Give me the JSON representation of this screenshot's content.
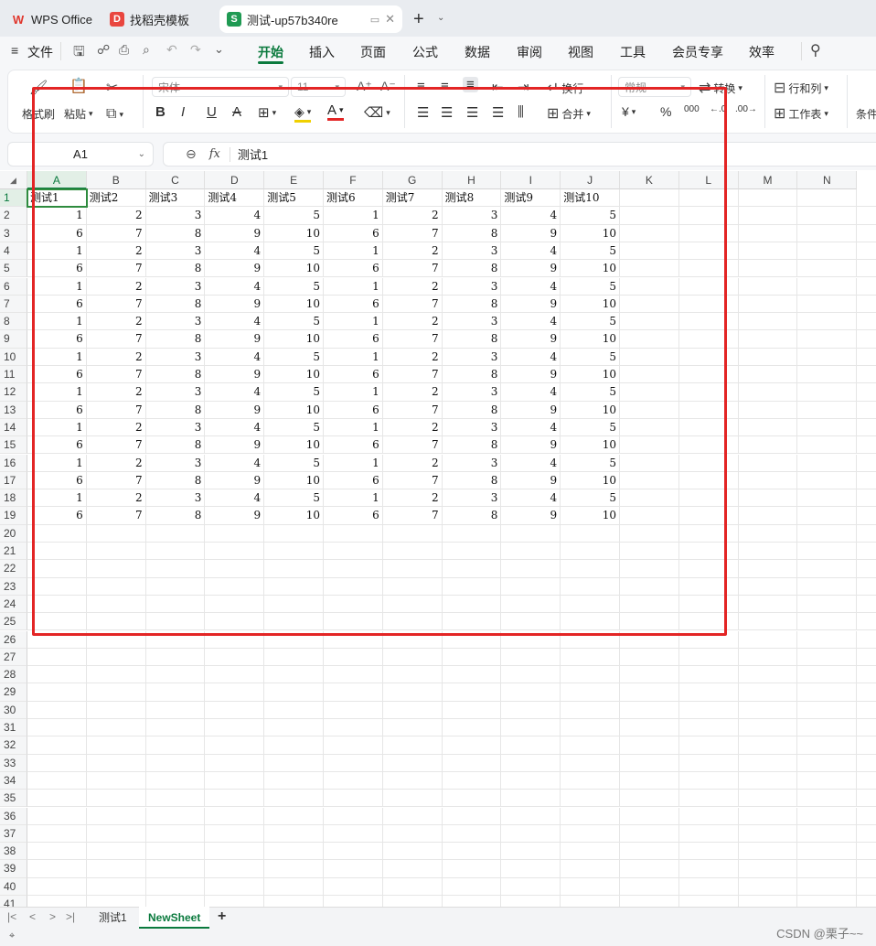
{
  "tabs": [
    {
      "label": "WPS Office",
      "icon": "wps-logo-icon"
    },
    {
      "label": "找稻壳模板",
      "icon": "docer-icon"
    },
    {
      "label": "测试-up57b340re",
      "icon": "spreadsheet-s-icon",
      "icon_text": "S"
    }
  ],
  "menu": {
    "file": "文件",
    "items": [
      "开始",
      "插入",
      "页面",
      "公式",
      "数据",
      "审阅",
      "视图",
      "工具",
      "会员专享",
      "效率"
    ],
    "active": "开始"
  },
  "ribbon": {
    "format_painter": "格式刷",
    "paste": "粘贴",
    "font_name": "宋体",
    "font_size": "11",
    "wrap": "换行",
    "merge": "合并",
    "number_format": "常规",
    "convert": "转换",
    "rows_cols": "行和列",
    "worksheet": "工作表",
    "conditional": "条件",
    "percent": "%",
    "thousands": "000",
    "currency": "¥"
  },
  "formula_bar": {
    "cell_ref": "A1",
    "fx": "fx",
    "content": "测试1"
  },
  "columns": [
    "A",
    "B",
    "C",
    "D",
    "E",
    "F",
    "G",
    "H",
    "I",
    "J",
    "K",
    "L",
    "M",
    "N"
  ],
  "row_count": 41,
  "headers": [
    "测试1",
    "测试2",
    "测试3",
    "测试4",
    "测试5",
    "测试6",
    "测试7",
    "测试8",
    "测试9",
    "测试10"
  ],
  "data_rows": [
    [
      1,
      2,
      3,
      4,
      5,
      1,
      2,
      3,
      4,
      5
    ],
    [
      6,
      7,
      8,
      9,
      10,
      6,
      7,
      8,
      9,
      10
    ],
    [
      1,
      2,
      3,
      4,
      5,
      1,
      2,
      3,
      4,
      5
    ],
    [
      6,
      7,
      8,
      9,
      10,
      6,
      7,
      8,
      9,
      10
    ],
    [
      1,
      2,
      3,
      4,
      5,
      1,
      2,
      3,
      4,
      5
    ],
    [
      6,
      7,
      8,
      9,
      10,
      6,
      7,
      8,
      9,
      10
    ],
    [
      1,
      2,
      3,
      4,
      5,
      1,
      2,
      3,
      4,
      5
    ],
    [
      6,
      7,
      8,
      9,
      10,
      6,
      7,
      8,
      9,
      10
    ],
    [
      1,
      2,
      3,
      4,
      5,
      1,
      2,
      3,
      4,
      5
    ],
    [
      6,
      7,
      8,
      9,
      10,
      6,
      7,
      8,
      9,
      10
    ],
    [
      1,
      2,
      3,
      4,
      5,
      1,
      2,
      3,
      4,
      5
    ],
    [
      6,
      7,
      8,
      9,
      10,
      6,
      7,
      8,
      9,
      10
    ],
    [
      1,
      2,
      3,
      4,
      5,
      1,
      2,
      3,
      4,
      5
    ],
    [
      6,
      7,
      8,
      9,
      10,
      6,
      7,
      8,
      9,
      10
    ],
    [
      1,
      2,
      3,
      4,
      5,
      1,
      2,
      3,
      4,
      5
    ],
    [
      6,
      7,
      8,
      9,
      10,
      6,
      7,
      8,
      9,
      10
    ],
    [
      1,
      2,
      3,
      4,
      5,
      1,
      2,
      3,
      4,
      5
    ],
    [
      6,
      7,
      8,
      9,
      10,
      6,
      7,
      8,
      9,
      10
    ]
  ],
  "sheets": [
    "测试1",
    "NewSheet"
  ],
  "active_sheet": "NewSheet",
  "watermark": "CSDN @栗子~~",
  "colors": {
    "accent": "#0b7a3e",
    "highlight": "#e32525"
  }
}
